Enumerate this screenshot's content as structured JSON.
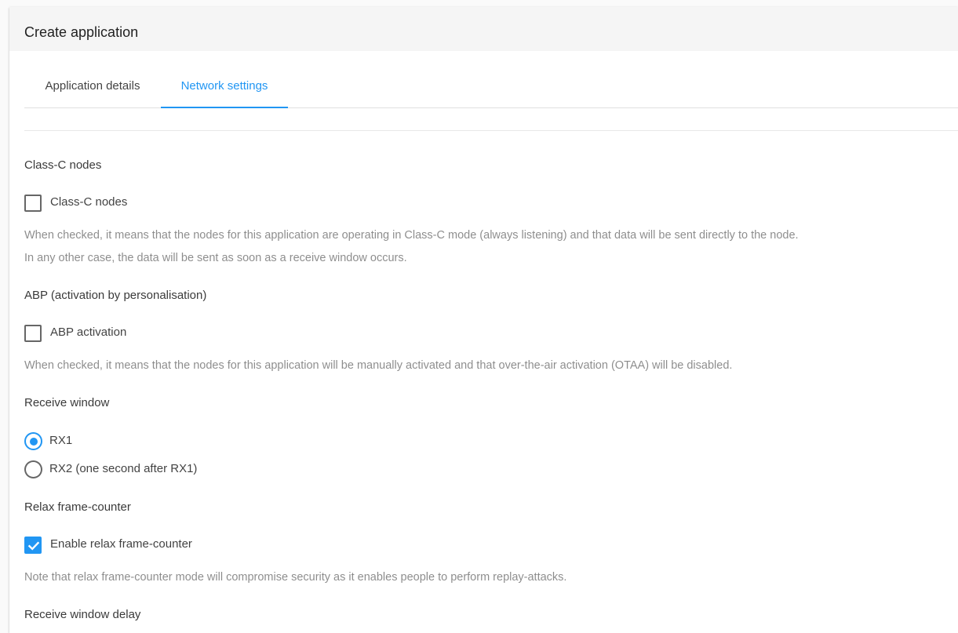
{
  "header": {
    "title": "Create application"
  },
  "tabs": [
    {
      "label": "Application details",
      "active": false
    },
    {
      "label": "Network settings",
      "active": true
    }
  ],
  "accent_color": "#2196f3",
  "sections": {
    "class_c": {
      "heading": "Class-C nodes",
      "checkbox_label": "Class-C nodes",
      "checked": false,
      "help_line1": "When checked, it means that the nodes for this application are operating in Class-C mode (always listening) and that data will be sent directly to the node.",
      "help_line2": "In any other case, the data will be sent as soon as a receive window occurs."
    },
    "abp": {
      "heading": "ABP (activation by personalisation)",
      "checkbox_label": "ABP activation",
      "checked": false,
      "help": "When checked, it means that the nodes for this application will be manually activated and that over-the-air activation (OTAA) will be disabled."
    },
    "receive_window": {
      "heading": "Receive window",
      "options": [
        {
          "label": "RX1",
          "selected": true
        },
        {
          "label": "RX2 (one second after RX1)",
          "selected": false
        }
      ]
    },
    "relax_fcnt": {
      "heading": "Relax frame-counter",
      "checkbox_label": "Enable relax frame-counter",
      "checked": true,
      "help": "Note that relax frame-counter mode will compromise security as it enables people to perform replay-attacks."
    },
    "receive_window_delay": {
      "heading": "Receive window delay"
    }
  }
}
